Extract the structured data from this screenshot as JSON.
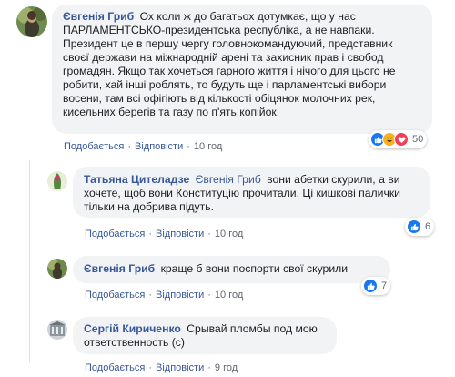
{
  "comments": [
    {
      "author": "Євгенія Гриб",
      "mention": "",
      "text": "Ох коли ж до багатьох дотумкає, що у нас ПАРЛАМЕНТСЬКО-президентська республіка, а не навпаки. Президент це в першу чергу головнокомандуючий, представник своєї держави на міжнародній арені та захисник прав і свобод громадян. Якщо так хочеться гарного життя і нічого для цього не робити, хай інші роблять, то будуть ще і парламентські вибори восени, там всі офігіють від кількості обіцянок молочних рек, кисельних берегів та газу по п'ять копійок.",
      "like": "Подобається",
      "reply": "Відповісти",
      "time": "10 год",
      "reactions_count": "50",
      "reactions": [
        "like-icon",
        "haha-icon",
        "love-icon"
      ]
    },
    {
      "author": "Татьяна Цителадзе",
      "mention": "Євгенія Гриб",
      "text": "вони абетки скурили, а ви хочете, щоб вони Конституцію прочитали. Ці кишкові палички тільки на добрива підуть.",
      "like": "Подобається",
      "reply": "Відповісти",
      "time": "10 год",
      "reactions_count": "6",
      "reactions": [
        "like-icon"
      ]
    },
    {
      "author": "Євгенія Гриб",
      "mention": "",
      "text": "краще б вони поспорти свої скурили",
      "like": "Подобається",
      "reply": "Відповісти",
      "time": "10 год",
      "reactions_count": "7",
      "reactions": [
        "like-icon"
      ]
    },
    {
      "author": "Сергій Кириченко",
      "mention": "",
      "text": "Срывай пломбы под мою ответственность (с)",
      "like": "Подобається",
      "reply": "Відповісти",
      "time": "9 год",
      "reactions_count": "",
      "reactions": []
    }
  ],
  "colors": {
    "link": "#385898",
    "bubble": "#f2f3f5",
    "like": "#1877f2",
    "love": "#f33e58",
    "haha": "#f7b125"
  }
}
